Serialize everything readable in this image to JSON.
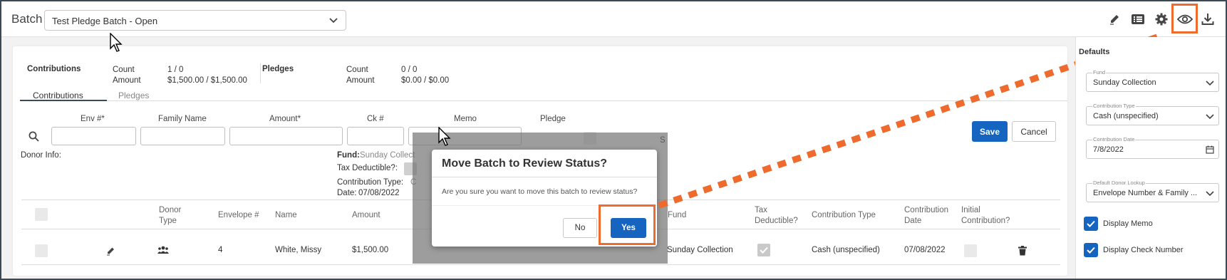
{
  "header": {
    "batch_label": "Batch",
    "batch_select_value": "Test Pledge Batch - Open"
  },
  "summary": {
    "contributions_label": "Contributions",
    "count_label": "Count",
    "amount_label": "Amount",
    "contrib_count": "1 / 0",
    "contrib_amount": "$1,500.00 / $1,500.00",
    "pledges_label": "Pledges",
    "pledge_count_label": "Count",
    "pledge_amount_label": "Amount",
    "pledge_count": "0 / 0",
    "pledge_amount": "$0.00 / $0.00"
  },
  "tabs": [
    "Contributions",
    "Pledges"
  ],
  "entry": {
    "headers": [
      "Env #*",
      "Family Name",
      "Amount*",
      "Ck #",
      "Memo",
      "Pledge"
    ],
    "save_label": "Save",
    "cancel_label": "Cancel"
  },
  "donor": {
    "donor_info_label": "Donor Info:",
    "fund_label": "Fund:",
    "fund_value": "Sunday Collect",
    "tax_label": "Tax Deductible?:",
    "type_label": "Contribution Type:",
    "type_value": "C",
    "date_label": "Date:",
    "date_value": "07/08/2022",
    "partial_s": "S"
  },
  "grid": {
    "headers": {
      "donor_type": "Donor Type",
      "envelope": "Envelope #",
      "name": "Name",
      "amount": "Amount",
      "fund": "Fund",
      "tax": "Tax Deductible?",
      "ctype": "Contribution Type",
      "cdate": "Contribution Date",
      "initial": "Initial Contribution?"
    },
    "row": {
      "envelope": "4",
      "name": "White, Missy",
      "amount": "$1,500.00",
      "fund": "Sunday Collection",
      "ctype": "Cash (unspecified)",
      "cdate": "07/08/2022"
    }
  },
  "modal": {
    "title": "Move Batch to Review Status?",
    "body": "Are you sure you want to move this batch to review status?",
    "no_label": "No",
    "yes_label": "Yes"
  },
  "sidebar": {
    "title": "Defaults",
    "fund_label": "Fund",
    "fund_value": "Sunday Collection",
    "type_label": "Contribution Type",
    "type_value": "Cash (unspecified)",
    "date_label": "Contribution Date",
    "date_value": "7/8/2022",
    "lookup_label": "Default Donor Lookup",
    "lookup_value": "Envelope Number & Family ...",
    "display_memo": "Display Memo",
    "display_check": "Display Check Number"
  },
  "colors": {
    "accent": "#1565c0",
    "highlight": "#ee6b2d",
    "frame": "#3b4856"
  },
  "icons": [
    "chevron-down-icon",
    "pencil-icon",
    "list-icon",
    "gear-icon",
    "eye-icon",
    "download-icon",
    "search-icon",
    "people-icon",
    "trash-icon",
    "calendar-icon",
    "check-icon"
  ]
}
